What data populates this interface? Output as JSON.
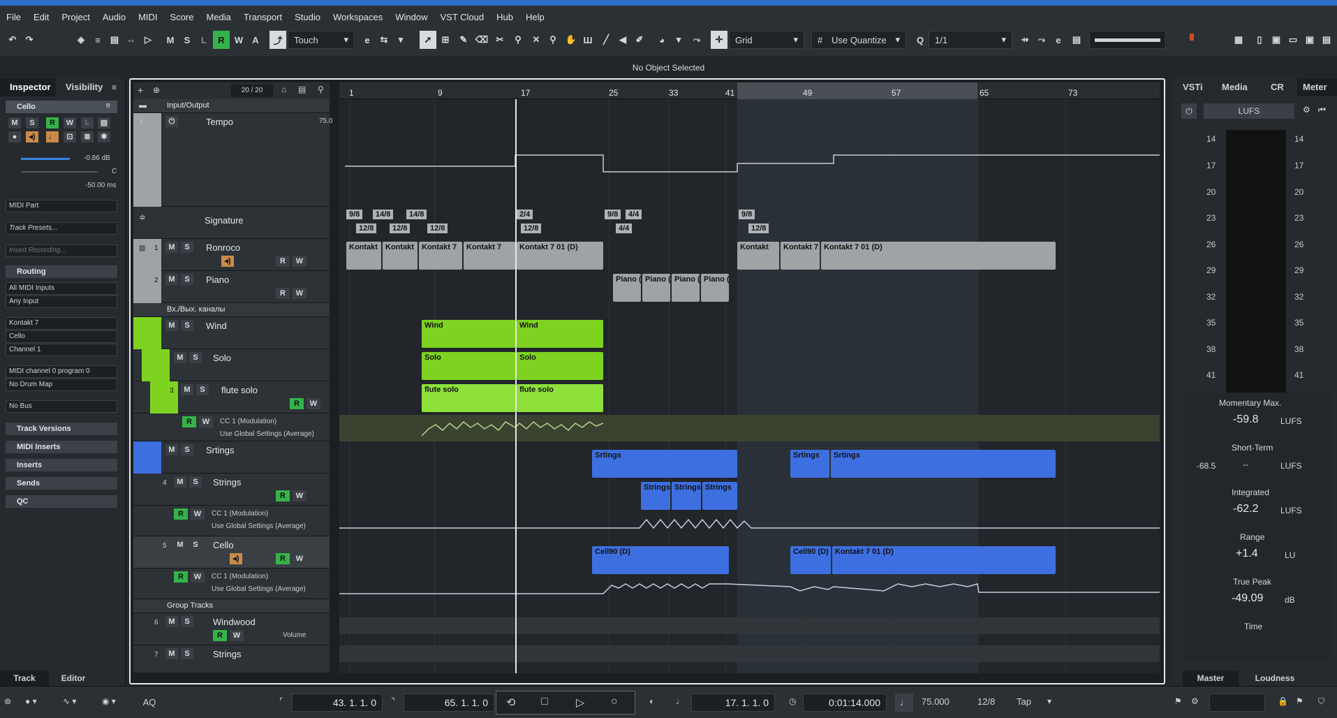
{
  "menu": [
    "File",
    "Edit",
    "Project",
    "Audio",
    "MIDI",
    "Score",
    "Media",
    "Transport",
    "Studio",
    "Workspaces",
    "Window",
    "VST Cloud",
    "Hub",
    "Help"
  ],
  "toolbar": {
    "m": "M",
    "s": "S",
    "l": "L",
    "r": "R",
    "w": "W",
    "a": "A",
    "automation_mode": "Touch",
    "grid_type": "Grid",
    "quantize_mode": "Use Quantize",
    "quantize_value": "1/1"
  },
  "status": "No Object Selected",
  "inspector": {
    "tab_inspector": "Inspector",
    "tab_visibility": "Visibility",
    "track_name": "Cello",
    "volume": "-0.86 dB",
    "pan": "C",
    "delay": "-50.00 ms",
    "midi_part": "MIDI Part",
    "track_presets": "Track Presets...",
    "insert_recording": "Insert Recording...",
    "routing": "Routing",
    "all_midi_inputs": "All MIDI Inputs",
    "any_input": "Any Input",
    "instrument": "Kontakt 7",
    "output": "Cello",
    "channel": "Channel 1",
    "program": "MIDI channel 0 program 0",
    "drum_map": "No Drum Map",
    "bus": "No Bus",
    "sections": [
      "Track Versions",
      "MIDI Inserts",
      "Inserts",
      "Sends",
      "QC"
    ],
    "bottom_track": "Track",
    "bottom_editor": "Editor",
    "m": "M",
    "s": "S",
    "r": "R",
    "w": "W",
    "l": "L"
  },
  "project": {
    "track_count": "20 / 20",
    "ruler": [
      "1",
      "9",
      "17",
      "25",
      "33",
      "41",
      "49",
      "57",
      "65",
      "73"
    ]
  },
  "tracks": {
    "io": "Input/Output",
    "tempo": "Tempo",
    "tempo_value": "75.0",
    "signature": "Signature",
    "ronroco": "Ronroco",
    "piano": "Piano",
    "folder_io": "Вх./Вых. каналы",
    "wind": "Wind",
    "solo": "Solo",
    "flute": "flute solo",
    "cc_mod": "CC 1 (Modulation)",
    "global": "Use Global Settings (Average)",
    "strings_folder": "Srtings",
    "strings": "Strings",
    "cello": "Cello",
    "group": "Group Tracks",
    "windwood": "Windwood",
    "volume": "Volume",
    "strings_group": "Strings",
    "n1": "1",
    "n2": "2",
    "n3": "3",
    "n4": "4",
    "n5": "5",
    "n6": "6",
    "n7": "7"
  },
  "events": {
    "sig": [
      "9/8",
      "14/8",
      "14/8",
      "12/8",
      "12/8",
      "12/8",
      "2/4",
      "12/8",
      "9/8",
      "4/4",
      "4/4",
      "9/8",
      "12/8"
    ],
    "kontakt": "Kontakt 7 01 (D)",
    "kontakt_short": "Kontakt",
    "kontakt_7": "Kontakt 7",
    "piano": "Piano (",
    "wind": "Wind",
    "solo": "Solo",
    "flute": "flute solo",
    "strings_folder": "Srtings",
    "strings": "Strings",
    "cello": "Cell90 (D)"
  },
  "meter": {
    "tabs": [
      "VSTi",
      "Media",
      "CR",
      "Meter"
    ],
    "mode": "LUFS",
    "scale_left": [
      "14",
      "17",
      "20",
      "23",
      "26",
      "29",
      "32",
      "35",
      "38",
      "41"
    ],
    "scale_right": [
      "14",
      "17",
      "20",
      "23",
      "26",
      "29",
      "32",
      "35",
      "38",
      "41"
    ],
    "momentary_label": "Momentary Max.",
    "momentary": "-59.8",
    "lufs": "LUFS",
    "short_label": "Short-Term",
    "short_left": "-68.5",
    "short_mid": "--",
    "integrated_label": "Integrated",
    "integrated": "-62.2",
    "range_label": "Range",
    "range": "+1.4",
    "lu": "LU",
    "peak_label": "True Peak",
    "peak": "-49.09",
    "db": "dB",
    "time_label": "Time",
    "bottom_master": "Master",
    "bottom_loudness": "Loudness"
  },
  "transport": {
    "aq": "AQ",
    "left_locator": "43. 1. 1.  0",
    "right_locator": "65. 1. 1.  0",
    "position": "17. 1. 1.  0",
    "time": "0:01:14.000",
    "tempo": "75.000",
    "signature": "12/8",
    "tap": "Tap"
  }
}
